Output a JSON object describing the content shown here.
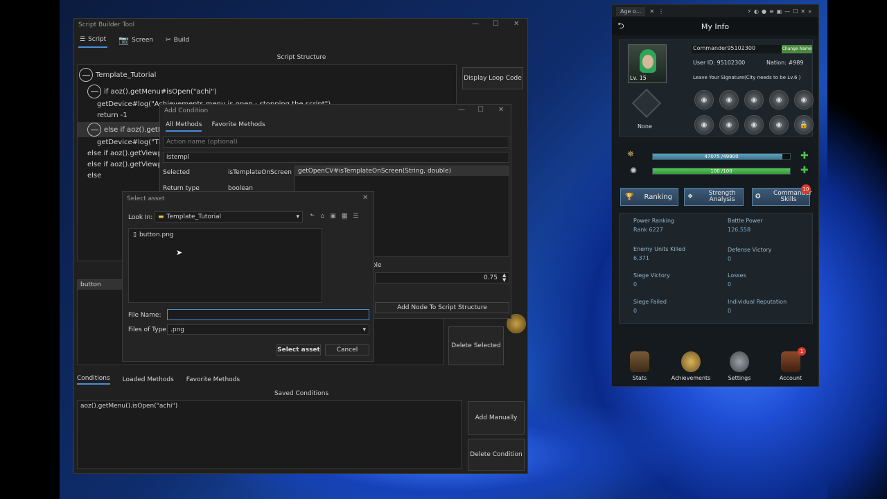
{
  "builder": {
    "title": "Script Builder Tool",
    "tabs": [
      {
        "label": "Script"
      },
      {
        "label": "Screen"
      },
      {
        "label": "Build"
      }
    ],
    "script_structure_title": "Script Structure",
    "tree": [
      "Template_Tutorial",
      "if aoz().getMenu#isOpen(\"achi\")",
      "getDevice#log(\"Achievements menu is open - stopping the script\")",
      "return -1",
      "else if aoz().getM",
      "getDevice#log(\"The",
      "else if aoz().getViewpo",
      "else if aoz().getViewpo",
      "else"
    ],
    "display_loop_code": "Display Loop Code",
    "button_label": "button",
    "delete_selected": "Delete Selected",
    "bottom_tabs": [
      {
        "label": "Conditions"
      },
      {
        "label": "Loaded Methods"
      },
      {
        "label": "Favorite Methods"
      }
    ],
    "saved_conditions_title": "Saved Conditions",
    "saved_condition": "aoz().getMenu().isOpen(\"achi\")",
    "add_manually": "Add Manually",
    "delete_condition": "Delete Condition"
  },
  "add_condition": {
    "title": "Add Condition",
    "tabs": [
      {
        "label": "All Methods"
      },
      {
        "label": "Favorite Methods"
      }
    ],
    "action_placeholder": "Action name (optional)",
    "search_value": "istempl",
    "selected_label": "Selected",
    "selected_value": "isTemplateOnScreen",
    "return_label": "Return type",
    "return_value": "boolean",
    "method_item": "getOpenCV#isTemplateOnScreen(String, double)",
    "param_partial": "ole",
    "threshold": "0.75",
    "add_node": "Add Node To Script Structure"
  },
  "select_asset": {
    "title": "Select asset",
    "look_in_label": "Look In:",
    "look_in_value": "Template_Tutorial",
    "file": "button.png",
    "file_name_label": "File Name:",
    "file_name_value": "",
    "files_of_type_label": "Files of Type:",
    "files_of_type_value": ".png",
    "select_button": "Select asset",
    "cancel_button": "Cancel"
  },
  "game": {
    "tab_title": "Age o...",
    "header": "My Info",
    "commander": "Commander95102300",
    "change_name": "Change Name",
    "user_id": "User ID: 95102300",
    "nation": "Nation: #989",
    "signature": "Leave Your Signature(City needs to be Lv.6 )",
    "level": "Lv. 15",
    "rank_none": "None",
    "exp_bar": {
      "text": "47075 /49900",
      "fraction": 0.943
    },
    "hp_bar": {
      "text": "100 /100",
      "fraction": 1.0
    },
    "buttons": [
      {
        "label": "Ranking"
      },
      {
        "label": "Strength Analysis"
      },
      {
        "label": "Commander Skills"
      }
    ],
    "skills_badge": "10",
    "stats": [
      {
        "label": "Power Ranking",
        "value": "Rank 6227"
      },
      {
        "label": "Battle Power",
        "value": "126,558"
      },
      {
        "label": "Enemy Units Killed",
        "value": "6,371"
      },
      {
        "label": "Defense Victory",
        "value": "0"
      },
      {
        "label": "Siege Victory",
        "value": "0"
      },
      {
        "label": "Losses",
        "value": "0"
      },
      {
        "label": "Siege Failed",
        "value": "0"
      },
      {
        "label": "Individual Reputation",
        "value": "0"
      }
    ],
    "nav": [
      {
        "label": "Stats"
      },
      {
        "label": "Achievements"
      },
      {
        "label": "Settings"
      },
      {
        "label": "Account"
      }
    ],
    "account_badge": "1"
  }
}
